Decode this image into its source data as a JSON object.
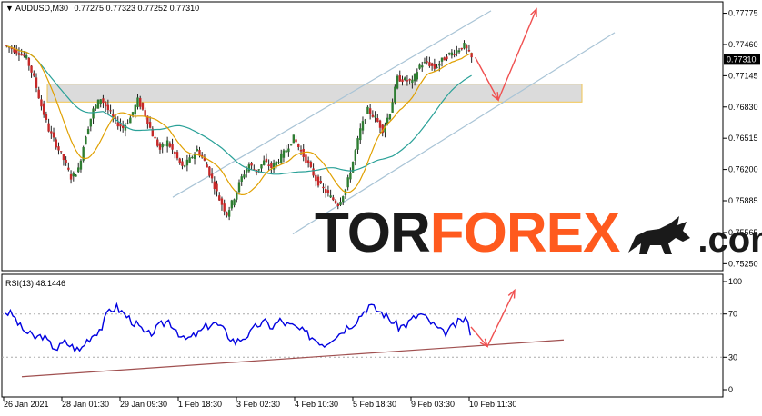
{
  "header": {
    "symbol": "AUDUSD,M30",
    "ohlc": "0.77275 0.77323 0.77252 0.77310"
  },
  "rsi_header": "RSI(13) 48.1446",
  "current_price": "0.77310",
  "logo": {
    "part1": "TOR",
    "part2": "FOREX",
    "part3": ".com"
  },
  "colors": {
    "candle_up": "#2e7d32",
    "candle_down": "#c62828",
    "ma_fast": "#e0a000",
    "ma_slow": "#2aa198",
    "channel": "#a9c4d6",
    "zone_fill": "#d8d8d8",
    "zone_border": "#f0c040",
    "arrow": "#f05050",
    "rsi_line": "#0000e0",
    "rsi_trend": "#a05050",
    "logo_orange": "#ff5a1e"
  },
  "chart_data": {
    "type": "candlestick",
    "price_axis": {
      "ticks": [
        "0.77775",
        "0.77460",
        "0.77145",
        "0.76830",
        "0.76515",
        "0.76200",
        "0.75885",
        "0.75565",
        "0.75250"
      ]
    },
    "time_axis": {
      "ticks": [
        "26 Jan 2021",
        "28 Jan 01:30",
        "29 Jan 09:30",
        "1 Feb 18:30",
        "3 Feb 02:30",
        "4 Feb 10:30",
        "5 Feb 18:30",
        "9 Feb 03:30",
        "10 Feb 11:30"
      ]
    },
    "rsi_axis": {
      "ticks": [
        "100",
        "70",
        "30",
        "0"
      ]
    },
    "price_path": [
      0.7745,
      0.7742,
      0.7738,
      0.7732,
      0.7712,
      0.7684,
      0.766,
      0.7645,
      0.763,
      0.7612,
      0.762,
      0.7655,
      0.768,
      0.7692,
      0.768,
      0.7668,
      0.7662,
      0.7672,
      0.769,
      0.7675,
      0.7655,
      0.764,
      0.7648,
      0.7635,
      0.7622,
      0.763,
      0.764,
      0.7628,
      0.761,
      0.759,
      0.7575,
      0.7592,
      0.7612,
      0.7625,
      0.7618,
      0.7628,
      0.7622,
      0.763,
      0.764,
      0.7652,
      0.7638,
      0.7625,
      0.761,
      0.76,
      0.7592,
      0.7585,
      0.76,
      0.7628,
      0.766,
      0.768,
      0.7672,
      0.766,
      0.7678,
      0.7712,
      0.771,
      0.7708,
      0.7725,
      0.7728,
      0.7722,
      0.773,
      0.7736,
      0.774,
      0.7745,
      0.7732
    ],
    "rsi_path": [
      72,
      69,
      58,
      52,
      48,
      50,
      42,
      38,
      44,
      40,
      36,
      46,
      52,
      58,
      74,
      76,
      70,
      64,
      58,
      50,
      54,
      60,
      64,
      56,
      46,
      48,
      52,
      58,
      62,
      58,
      50,
      44,
      48,
      52,
      60,
      62,
      58,
      64,
      60,
      58,
      54,
      50,
      46,
      42,
      48,
      52,
      58,
      62,
      70,
      78,
      74,
      70,
      64,
      58,
      60,
      66,
      70,
      64,
      58,
      52,
      56,
      62,
      66,
      48
    ]
  }
}
